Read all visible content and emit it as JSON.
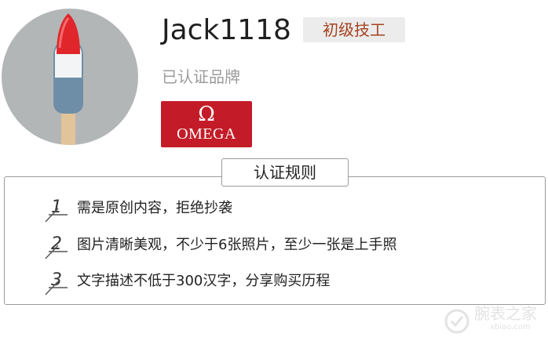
{
  "profile": {
    "username": "Jack1118",
    "level": "初级技工",
    "certified_label": "已认证品牌",
    "brand": {
      "symbol": "Ω",
      "name": "OMEGA",
      "color": "#c31c28"
    },
    "avatar_icon": "popsicle-icon"
  },
  "rules": {
    "title": "认证规则",
    "items": [
      {
        "num": "1",
        "text": "需是原创内容，拒绝抄袭"
      },
      {
        "num": "2",
        "text": "图片清晰美观，不少于6张照片，至少一张是上手照"
      },
      {
        "num": "3",
        "text": "文字描述不低于300汉字，分享购买历程"
      }
    ]
  },
  "watermark": {
    "main": "腕表之家",
    "sub": "xbiao.com"
  }
}
